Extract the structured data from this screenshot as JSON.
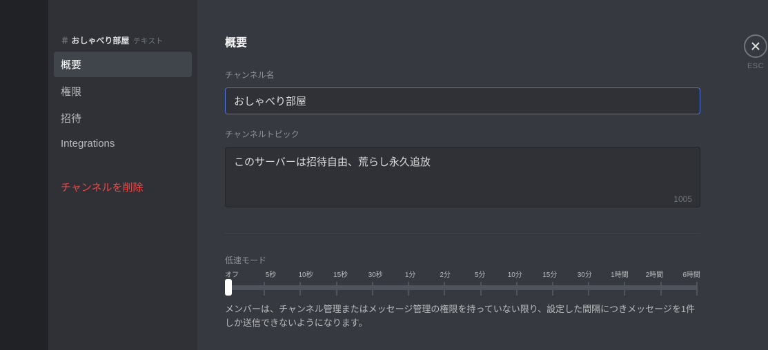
{
  "sidebar": {
    "header_prefix": "＃",
    "header_channel": "おしゃべり部屋",
    "header_tag": "テキスト",
    "items": [
      {
        "label": "概要",
        "active": true
      },
      {
        "label": "権限",
        "active": false
      },
      {
        "label": "招待",
        "active": false
      },
      {
        "label": "Integrations",
        "active": false
      }
    ],
    "delete_label": "チャンネルを削除"
  },
  "esc": {
    "label": "ESC"
  },
  "main": {
    "title": "概要",
    "name_label": "チャンネル名",
    "name_value": "おしゃべり部屋",
    "topic_label": "チャンネルトピック",
    "topic_value": "このサーバーは招待自由、荒らし永久追放",
    "topic_counter": "1005",
    "slowmode_label": "低速モード",
    "slowmode_ticks": [
      "オフ",
      "5秒",
      "10秒",
      "15秒",
      "30秒",
      "1分",
      "2分",
      "5分",
      "10分",
      "15分",
      "30分",
      "1時間",
      "2時間",
      "6時間"
    ],
    "slowmode_help": "メンバーは、チャンネル管理またはメッセージ管理の権限を持っていない限り、設定した間隔につきメッセージを1件しか送信できないようになります。"
  }
}
